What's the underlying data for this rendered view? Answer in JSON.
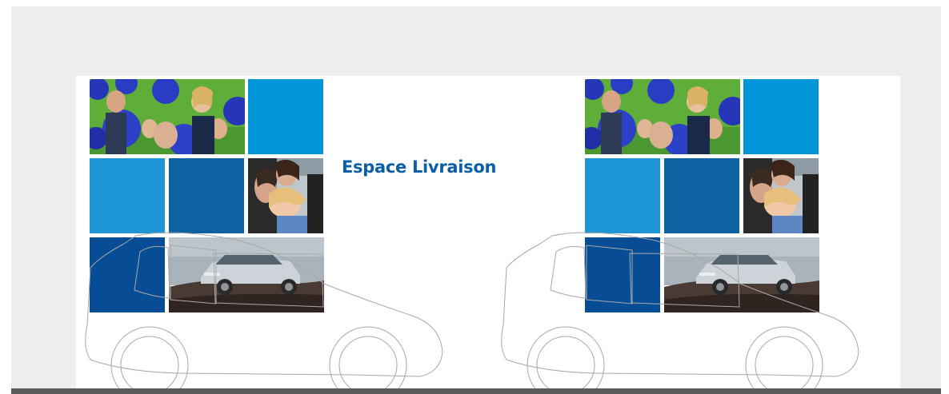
{
  "title": "Espace Livraison",
  "colors": {
    "frame_gray": "#eeeeee",
    "panel_white": "#ffffff",
    "bottom_bar": "#5a5a5a",
    "tile_sky": "#0094d9",
    "tile_light_blue": "#1e96d6",
    "tile_mid_blue": "#0d62a1",
    "tile_dark_blue": "#064d96",
    "title_blue": "#0b5ea8"
  },
  "mosaic_tiles": [
    {
      "kind": "photo",
      "subject": "balloons-crowd-photo"
    },
    {
      "kind": "solid",
      "color": "tile_sky"
    },
    {
      "kind": "solid",
      "color": "tile_light_blue"
    },
    {
      "kind": "solid",
      "color": "tile_mid_blue"
    },
    {
      "kind": "photo",
      "subject": "couple-in-car-photo"
    },
    {
      "kind": "solid",
      "color": "tile_dark_blue"
    },
    {
      "kind": "photo",
      "subject": "suv-offroad-photo"
    }
  ],
  "icons": [
    "car-outline-icon"
  ]
}
